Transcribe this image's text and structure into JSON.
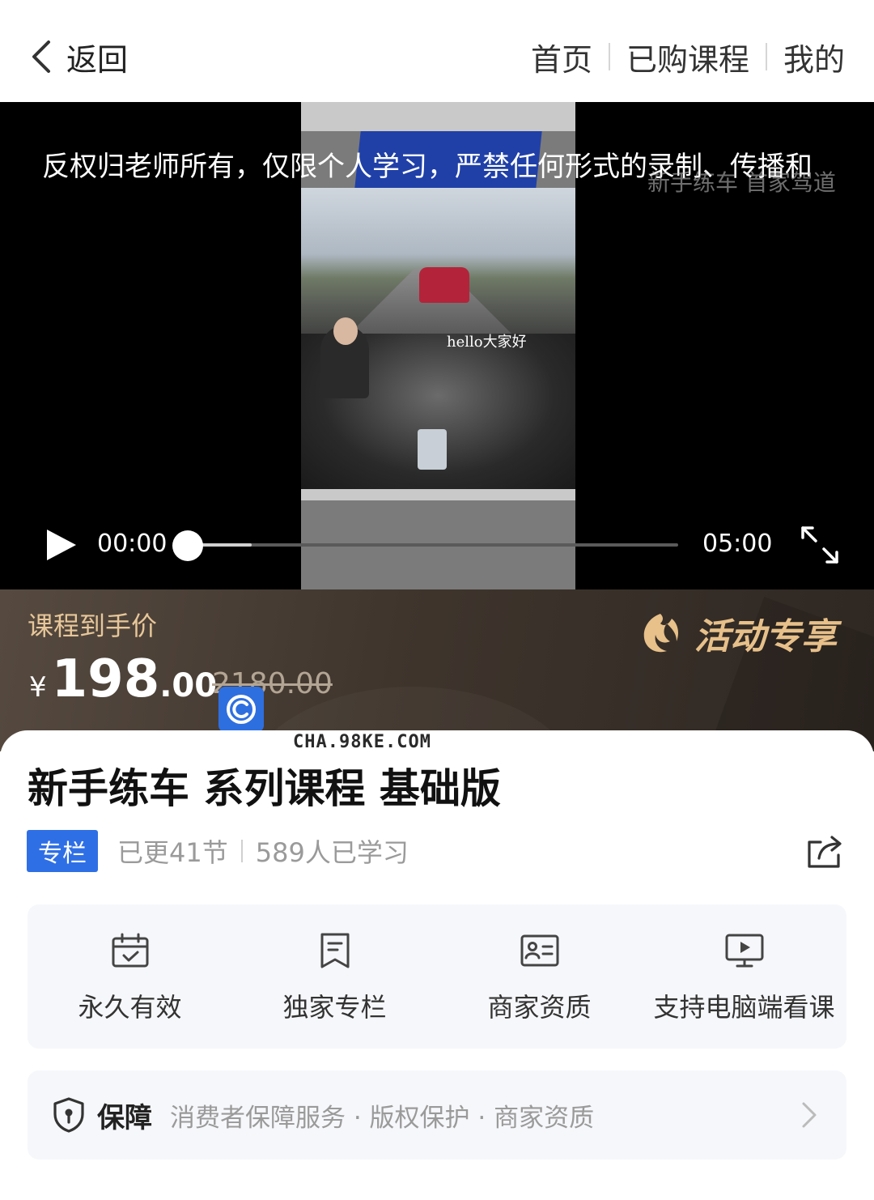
{
  "header": {
    "back_label": "返回",
    "nav": [
      "首页",
      "已购课程",
      "我的"
    ]
  },
  "video": {
    "copyright_notice": "反权归老师所有，仅限个人学习，严禁任何形式的录制、传播和",
    "watermark": "新手练车 首家驾道",
    "in_video_caption": "hello大家好",
    "current_time": "00:00",
    "duration": "05:00",
    "progress_fraction": 0,
    "buffered_fraction": 0.13
  },
  "price": {
    "label": "课程到手价",
    "currency": "¥",
    "integer": "198",
    "decimal": ".00",
    "original": "2180.00",
    "activity_badge": "活动专享",
    "site_watermark": "CHA.98KE.COM"
  },
  "course": {
    "title": "新手练车 系列课程 基础版",
    "tag": "专栏",
    "updated": "已更41节",
    "learners": "589人已学习"
  },
  "features": [
    {
      "label": "永久有效",
      "icon": "calendar-check-icon"
    },
    {
      "label": "独家专栏",
      "icon": "bookmark-doc-icon"
    },
    {
      "label": "商家资质",
      "icon": "id-card-icon"
    },
    {
      "label": "支持电脑端看课",
      "icon": "monitor-play-icon"
    }
  ],
  "guarantee": {
    "title": "保障",
    "items": "消费者保障服务 · 版权保护 · 商家资质"
  },
  "colors": {
    "accent_blue": "#2f6fe6",
    "gold": "#e7c79a",
    "price_band": "#3f352d"
  }
}
